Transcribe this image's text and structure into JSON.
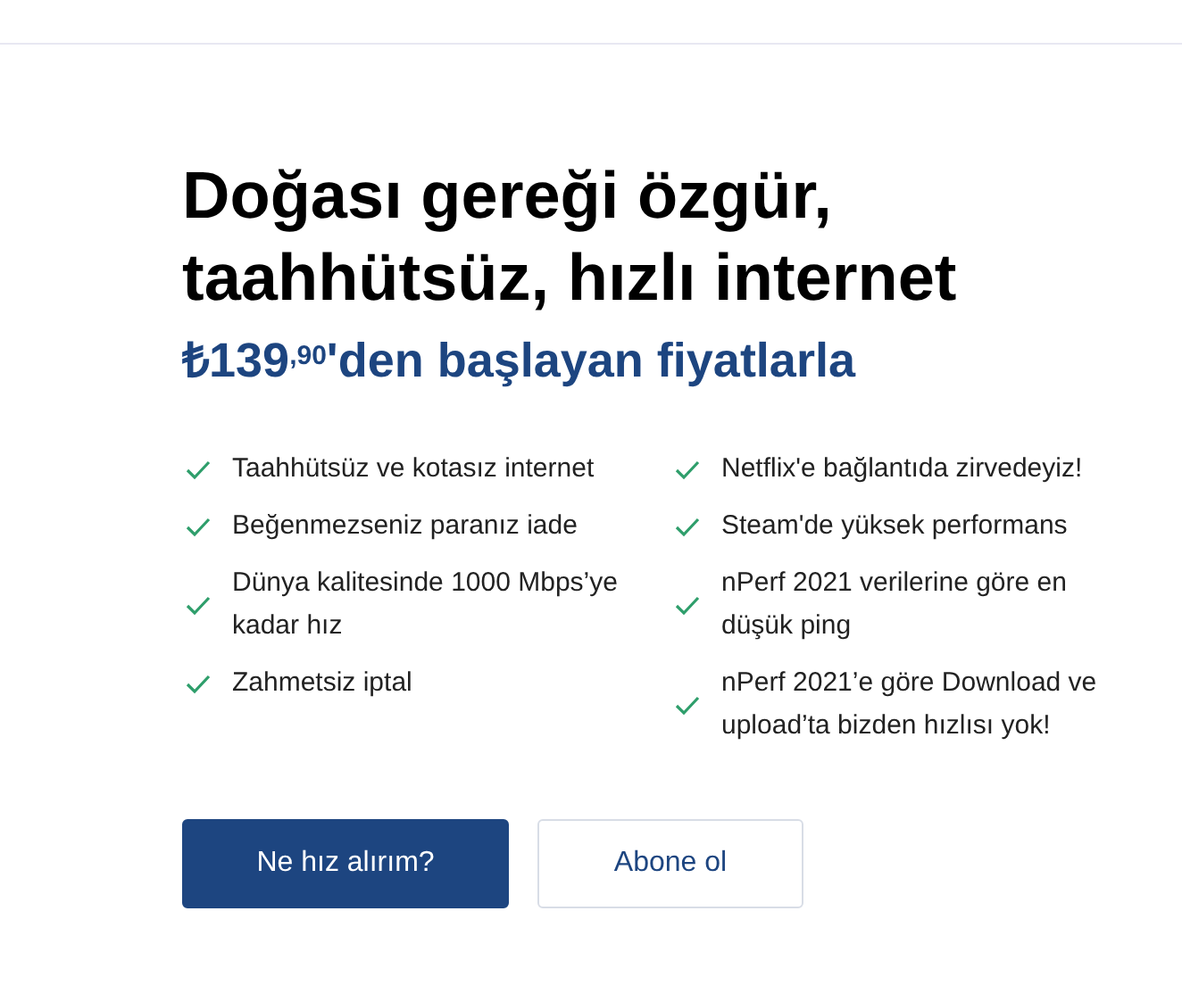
{
  "hero": {
    "title_lines": [
      "Doğası gereği özgür,",
      "taahhütsüz, hızlı internet"
    ],
    "price_line": "₺139$^{,90}$'den başlayan fiyatlarla"
  },
  "features": {
    "column_1": [
      "Taahhütsüz ve kotasız internet",
      "Beğenmezseniz paranız iade",
      "Dünya kalitesinde 1000 Mbps’ye kadar hız",
      "Zahmetsiz iptal"
    ],
    "column_2": [
      "Netflix'e bağlantıda zirvedeyiz!",
      "Steam'de yüksek performans",
      "nPerf 2021 verilerine göre en düşük ping",
      "nPerf 2021’e göre Download ve upload’ta bizden hızlısı yok!"
    ]
  },
  "buttons": [
    {
      "label": "Ne hız alırım?",
      "kind": "primary"
    },
    {
      "label": "Abone ol",
      "kind": "secondary"
    }
  ]
}
